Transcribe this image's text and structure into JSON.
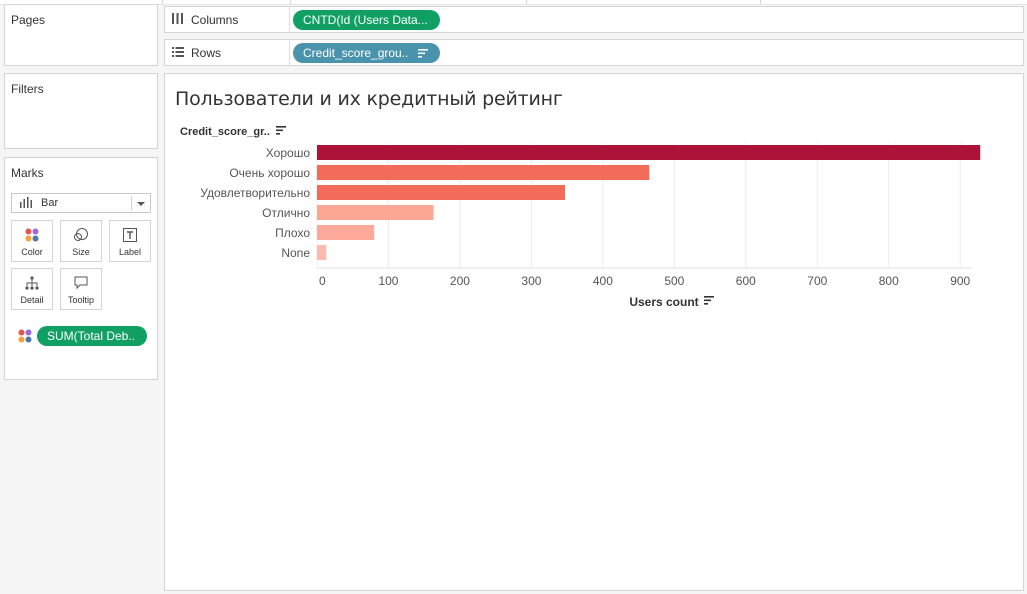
{
  "panels": {
    "pages_title": "Pages",
    "filters_title": "Filters",
    "marks_title": "Marks"
  },
  "shelves": {
    "columns": {
      "label": "Columns",
      "pill": "CNTD(Id (Users Data..."
    },
    "rows": {
      "label": "Rows",
      "pill": "Credit_score_grou.."
    }
  },
  "marks": {
    "mark_type": "Bar",
    "buttons": {
      "color": "Color",
      "size": "Size",
      "label": "Label",
      "detail": "Detail",
      "tooltip": "Tooltip"
    },
    "color_pill": "SUM(Total Deb.."
  },
  "chart": {
    "title": "Пользователи и их кредитный рейтинг",
    "row_header": "Credit_score_gr..",
    "xlabel": "Users count"
  },
  "chart_data": {
    "type": "bar",
    "orientation": "horizontal",
    "title": "Пользователи и их кредитный рейтинг",
    "xlabel": "Users count",
    "ylabel": "Credit_score_gr..",
    "categories": [
      "Хорошо",
      "Очень хорошо",
      "Удовлетворительно",
      "Отлично",
      "Плохо",
      "None"
    ],
    "values": [
      928,
      465,
      347,
      163,
      80,
      13
    ],
    "colors": [
      "#ac1339",
      "#f36c5a",
      "#f36c5a",
      "#fca694",
      "#fca99a",
      "#fdbbb0"
    ],
    "xlim": [
      0,
      1000
    ],
    "xticks": [
      0,
      100,
      200,
      300,
      400,
      500,
      600,
      700,
      800,
      900
    ],
    "grid": "vertical"
  }
}
